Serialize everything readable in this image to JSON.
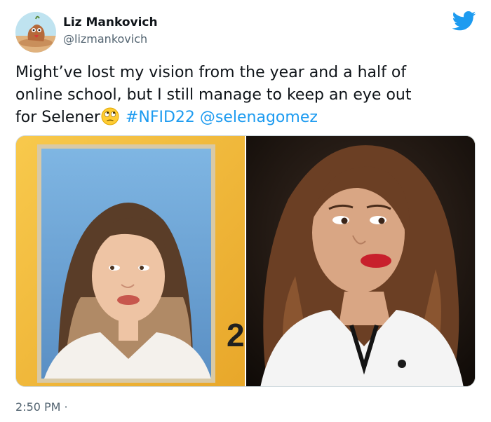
{
  "author": {
    "name": "Liz Mankovich",
    "handle": "@lizmankovich"
  },
  "tweet": {
    "text_line1": "Might’ve lost my vision from the year and a half of",
    "text_line2": "online school, but I still manage to keep an eye out",
    "text_line3_prefix": "for Selener",
    "emoji": "eye-roll-emoji",
    "hashtag": "#NFID22",
    "mention": "@selenagomez",
    "time": "2:50 PM ·"
  },
  "media": {
    "left_photo": "yearbook-portrait",
    "left_photo_marker": "2",
    "right_photo": "celebrity-photo"
  },
  "icons": {
    "brand": "twitter-bird-icon"
  },
  "colors": {
    "link": "#1d9bf0",
    "brand": "#1d9bf0",
    "secondary_text": "#536471",
    "yearbook_frame": "#f2b53a"
  }
}
